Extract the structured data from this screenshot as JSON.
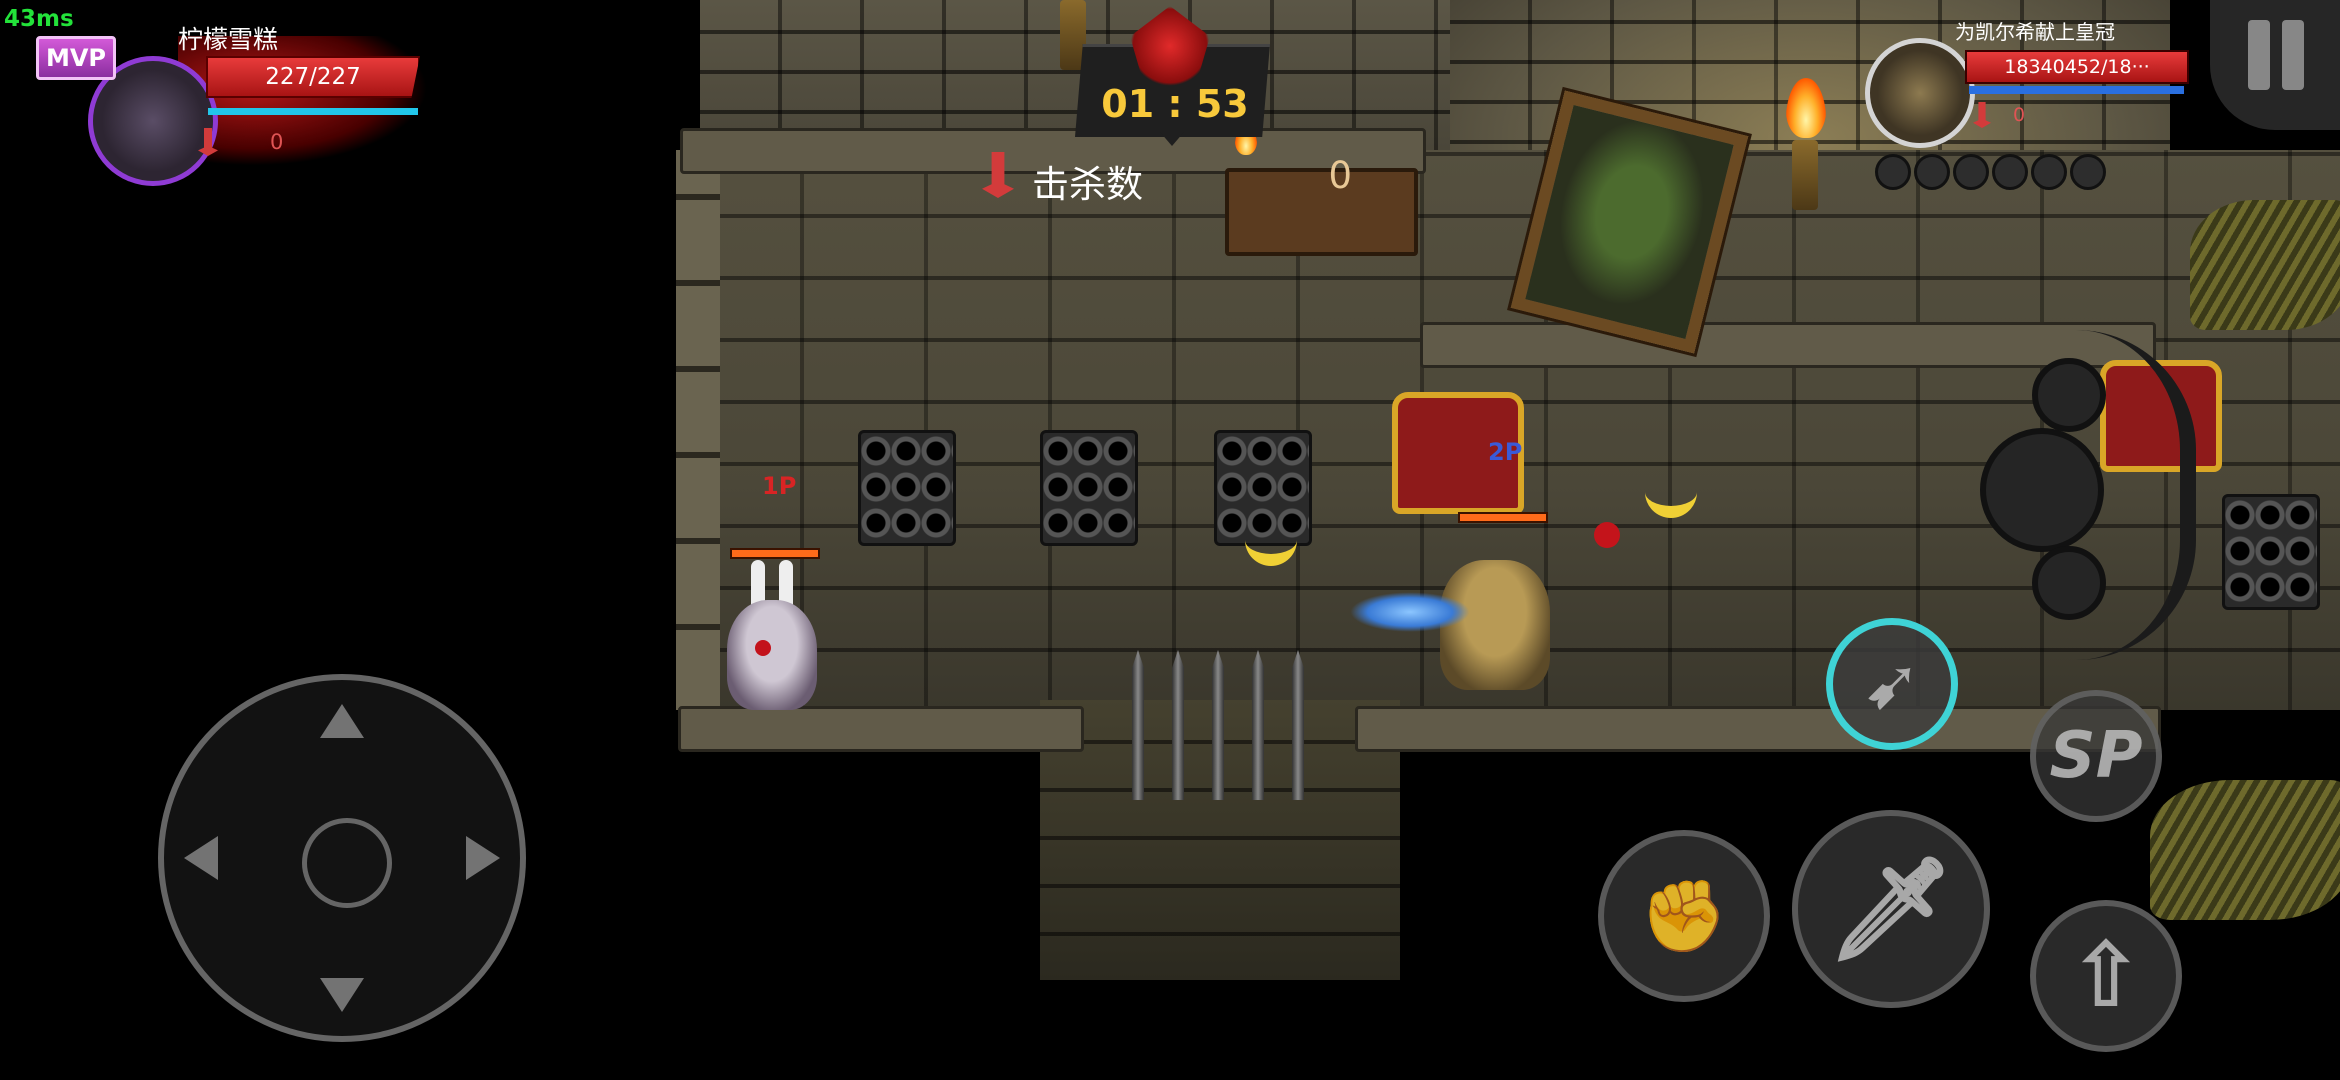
{
  "hud": {
    "ping": "43ms",
    "player1": {
      "badge": "MVP",
      "name": "柠檬雪糕",
      "hp_text": "227/227",
      "hp_fraction": 1.0,
      "kills": "0"
    },
    "match": {
      "timer": "01 : 53",
      "kills_label": "击杀数",
      "kills_value": "0"
    },
    "player2": {
      "name": "为凯尔希献上皇冠",
      "hp_text": "18340452/18···",
      "kills": "0",
      "empty_slots": 6
    }
  },
  "markers": {
    "p1": "1P",
    "p2": "2P"
  },
  "controls": {
    "joystick": "movement-joystick",
    "skill_sp_label": "SP"
  },
  "colors": {
    "hp_red": "#d81f1f",
    "mana_cyan": "#22c6ea",
    "timer_gold": "#f8c93b",
    "skill_active_ring": "#3fd3d6",
    "mvp_purple": "#b33fc8",
    "ping_green": "#23e23a"
  },
  "icons": {
    "kills": "kill-count-icon",
    "pause": "pause-icon",
    "timer": "timer-emblem-icon",
    "attack": "sword-attack-icon",
    "dash": "dash-skill-icon",
    "punch": "punch-skill-icon",
    "jump": "jump-icon"
  }
}
